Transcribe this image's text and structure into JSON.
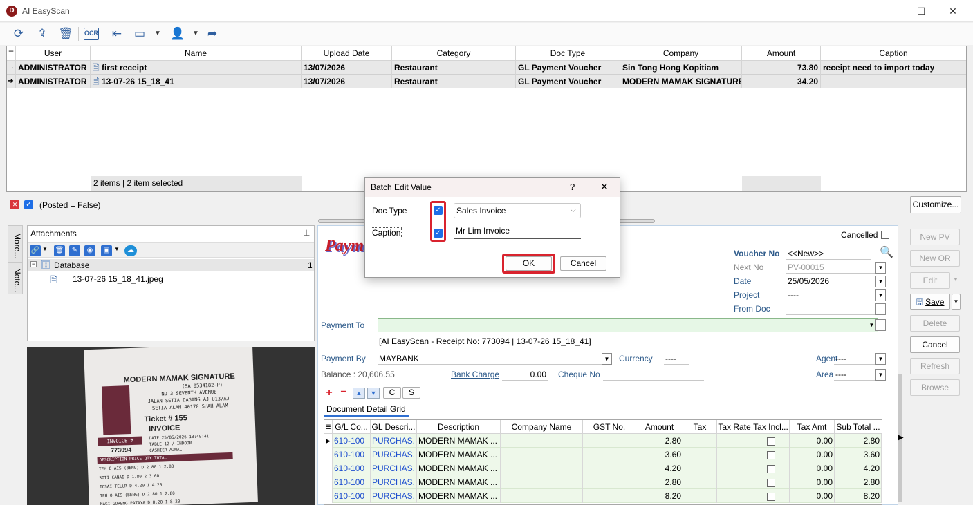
{
  "window": {
    "title": "AI EasyScan",
    "logo": "D",
    "minimize": "—",
    "maximize": "☐",
    "close": "✕"
  },
  "toolbar_icons": [
    "refresh-icon",
    "upload-icon",
    "delete-icon",
    "ocr-icon",
    "import-icon",
    "layout-icon",
    "user-icon",
    "share-icon"
  ],
  "toolbar": {
    "ocr_label": "OCR"
  },
  "grid": {
    "columns": [
      "User",
      "Name",
      "Upload Date",
      "Category",
      "Doc Type",
      "Company",
      "Amount",
      "Caption"
    ],
    "rows": [
      {
        "user": "ADMINISTRATOR",
        "name": "first receipt",
        "upload_date": "13/07/2026",
        "category": "Restaurant",
        "doc_type": "GL Payment Voucher",
        "company": "Sin Tong Hong Kopitiam",
        "amount": "73.80",
        "caption": "receipt need to import today"
      },
      {
        "user": "ADMINISTRATOR",
        "name": "13-07-26 15_18_41",
        "upload_date": "13/07/2026",
        "category": "Restaurant",
        "doc_type": "GL Payment Voucher",
        "company": "MODERN MAMAK SIGNATURE",
        "amount": "34.20",
        "caption": ""
      }
    ],
    "footer": "2 items |  2 item selected"
  },
  "filter": {
    "text": "(Posted = False)",
    "customize": "Customize..."
  },
  "side_tabs": {
    "more": "More...",
    "notes": "Note..."
  },
  "attachments": {
    "title": "Attachments",
    "tree_root": "Database",
    "tree_count": "1",
    "file": "13-07-26 15_18_41.jpeg"
  },
  "receipt": {
    "store": "MODERN MAMAK SIGNATURE",
    "reg": "(SA 0534182-P)",
    "addr1": "NO 3 SEVENTH AVENUE",
    "addr2": "JALAN SETIA DAGANG AJ U13/AJ",
    "addr3": "SETIA ALAM 40170 SHAH ALAM",
    "ticket": "Ticket # 155",
    "invoice": "INVOICE",
    "invoice_no_label": "INVOICE #",
    "invoice_no": "773094",
    "date": "DATE     25/05/2026 13:49:41",
    "table": "TABLE    12 / INDOOR",
    "cashier": "CASHIER  AJMAL",
    "headers": "DESCRIPTION        PRICE  QTY  TOTAL",
    "items": [
      "TEH O AIS (BENG)   D  2.80   1   2.80",
      "ROTI CANAI         D  1.80   2   3.60",
      "TOSAI TELUR        D  4.20   1   4.20",
      "TEH O AIS (BENG)   D  2.80   1   2.80",
      "NASI GORENG PATAYA D  8.20   1   8.20"
    ]
  },
  "form": {
    "title": "Payment Voucher",
    "cancelled_label": "Cancelled",
    "voucher_no_label": "Voucher No",
    "voucher_no": "<<New>>",
    "next_no_label": "Next No",
    "next_no": "PV-00015",
    "date_label": "Date",
    "date": "25/05/2026",
    "project_label": "Project",
    "project": "----",
    "from_doc_label": "From Doc",
    "payment_to_label": "Payment To",
    "payment_to_desc": "[AI EasyScan - Receipt No: 773094 | 13-07-26 15_18_41]",
    "payment_by_label": "Payment By",
    "payment_by": "MAYBANK",
    "currency_label": "Currency",
    "currency": "----",
    "agent_label": "Agent",
    "agent": "----",
    "balance_text": "Balance :  20,606.55",
    "bank_charge_label": "Bank Charge",
    "bank_charge": "0.00",
    "cheque_no_label": "Cheque No",
    "area_label": "Area",
    "area": "----",
    "c_btn": "C",
    "s_btn": "S",
    "detail_tab": "Document Detail Grid"
  },
  "detail_grid": {
    "columns": [
      "G/L Co...",
      "GL Descri...",
      "Description",
      "Company Name",
      "GST No.",
      "Amount",
      "Tax",
      "Tax Rate",
      "Tax Incl...",
      "Tax Amt",
      "Sub Total ..."
    ],
    "rows": [
      {
        "gl_code": "610-100",
        "gl_desc": "PURCHAS...",
        "desc": "MODERN MAMAK ...",
        "amount": "2.80",
        "tax_amt": "0.00",
        "sub_total": "2.80"
      },
      {
        "gl_code": "610-100",
        "gl_desc": "PURCHAS...",
        "desc": "MODERN MAMAK ...",
        "amount": "3.60",
        "tax_amt": "0.00",
        "sub_total": "3.60"
      },
      {
        "gl_code": "610-100",
        "gl_desc": "PURCHAS...",
        "desc": "MODERN MAMAK ...",
        "amount": "4.20",
        "tax_amt": "0.00",
        "sub_total": "4.20"
      },
      {
        "gl_code": "610-100",
        "gl_desc": "PURCHAS...",
        "desc": "MODERN MAMAK ...",
        "amount": "2.80",
        "tax_amt": "0.00",
        "sub_total": "2.80"
      },
      {
        "gl_code": "610-100",
        "gl_desc": "PURCHAS...",
        "desc": "MODERN MAMAK ...",
        "amount": "8.20",
        "tax_amt": "0.00",
        "sub_total": "8.20"
      }
    ]
  },
  "actions": {
    "new_pv": "New PV",
    "new_or": "New OR",
    "edit": "Edit",
    "save": "Save",
    "delete": "Delete",
    "cancel": "Cancel",
    "refresh": "Refresh",
    "browse": "Browse"
  },
  "dialog": {
    "title": "Batch Edit Value",
    "help": "?",
    "close": "✕",
    "doc_type_label": "Doc Type",
    "doc_type_value": "Sales Invoice",
    "caption_label": "Caption",
    "caption_value": "Mr Lim Invoice",
    "ok": "OK",
    "cancel": "Cancel"
  },
  "colors": {
    "accent": "#1e6ee6",
    "highlight": "#d9232e",
    "row_green": "#eef8ea",
    "link_blue": "#1f4fcf"
  }
}
